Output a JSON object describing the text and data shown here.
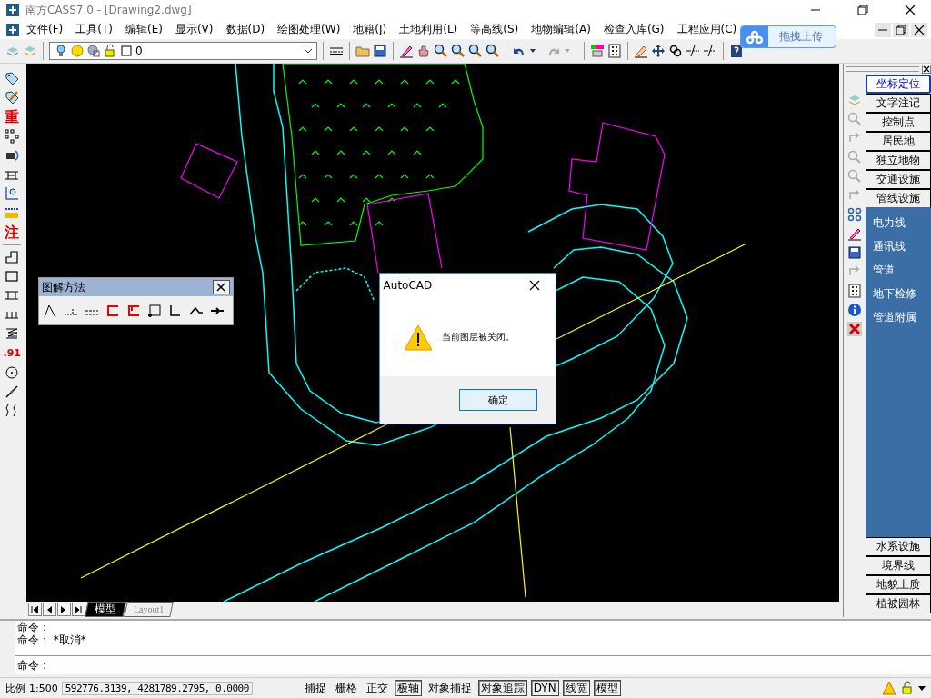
{
  "window": {
    "title": "南方CASS7.0 - [Drawing2.dwg]"
  },
  "menu": [
    {
      "label": "文件(F)"
    },
    {
      "label": "工具(T)"
    },
    {
      "label": "编辑(E)"
    },
    {
      "label": "显示(V)"
    },
    {
      "label": "数据(D)"
    },
    {
      "label": "绘图处理(W)"
    },
    {
      "label": "地籍(J)"
    },
    {
      "label": "土地利用(L)"
    },
    {
      "label": "等高线(S)"
    },
    {
      "label": "地物编辑(A)"
    },
    {
      "label": "检查入库(G)"
    },
    {
      "label": "工程应用(C)"
    }
  ],
  "upload_button": {
    "label": "拖拽上传"
  },
  "layer_dropdown": {
    "value": "0"
  },
  "left_toolbar_glyphs": [
    {
      "text": "重"
    },
    {
      "text": "注"
    },
    {
      "text": ".91"
    }
  ],
  "categories": [
    {
      "label": "坐标定位",
      "selected": true,
      "expanded": false
    },
    {
      "label": "文字注记",
      "selected": false,
      "expanded": false
    },
    {
      "label": "控制点",
      "selected": false,
      "expanded": false
    },
    {
      "label": "居民地",
      "selected": false,
      "expanded": false
    },
    {
      "label": "独立地物",
      "selected": false,
      "expanded": false
    },
    {
      "label": "交通设施",
      "selected": false,
      "expanded": false
    },
    {
      "label": "管线设施",
      "selected": false,
      "expanded": true,
      "children": [
        {
          "label": "电力线"
        },
        {
          "label": "通讯线"
        },
        {
          "label": "管道"
        },
        {
          "label": "地下检修"
        },
        {
          "label": "管道附属"
        }
      ]
    },
    {
      "label": "水系设施",
      "selected": false,
      "expanded": false
    },
    {
      "label": "境界线",
      "selected": false,
      "expanded": false
    },
    {
      "label": "地貌土质",
      "selected": false,
      "expanded": false
    },
    {
      "label": "植被园林",
      "selected": false,
      "expanded": false
    }
  ],
  "floating_toolbar": {
    "title": "图解方法"
  },
  "dialog": {
    "title": "AutoCAD",
    "message": "当前图层被关闭。",
    "button": "确定"
  },
  "layout_tabs": [
    {
      "label": "模型",
      "selected": true
    },
    {
      "label": "Layout1",
      "selected": false
    }
  ],
  "command_history": [
    "命令：",
    "命令： *取消*"
  ],
  "command_prompt": "命令：",
  "status_bar": {
    "scale_label": "比例",
    "scale": "1:500",
    "coordinates": "592776.3139, 4281789.2795, 0.0000",
    "toggles": [
      {
        "label": "捕捉",
        "on": false
      },
      {
        "label": "栅格",
        "on": false
      },
      {
        "label": "正交",
        "on": false
      },
      {
        "label": "极轴",
        "on": true
      },
      {
        "label": "对象捕捉",
        "on": false
      },
      {
        "label": "对象追踪",
        "on": true
      },
      {
        "label": "DYN",
        "on": true
      },
      {
        "label": "线宽",
        "on": true
      },
      {
        "label": "模型",
        "on": true
      }
    ]
  }
}
